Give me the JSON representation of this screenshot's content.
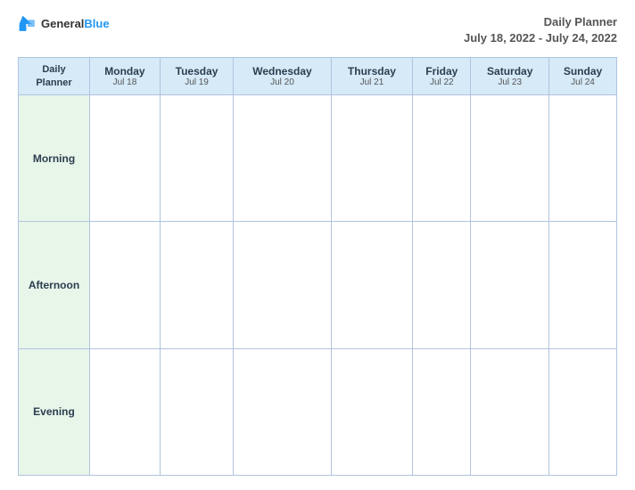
{
  "logo": {
    "brand": "General",
    "brand_blue": "Blue"
  },
  "header": {
    "title": "Daily Planner",
    "date_range": "July 18, 2022 - July 24, 2022"
  },
  "table": {
    "first_col": {
      "line1": "Daily",
      "line2": "Planner"
    },
    "columns": [
      {
        "day": "Monday",
        "date": "Jul 18"
      },
      {
        "day": "Tuesday",
        "date": "Jul 19"
      },
      {
        "day": "Wednesday",
        "date": "Jul 20"
      },
      {
        "day": "Thursday",
        "date": "Jul 21"
      },
      {
        "day": "Friday",
        "date": "Jul 22"
      },
      {
        "day": "Saturday",
        "date": "Jul 23"
      },
      {
        "day": "Sunday",
        "date": "Jul 24"
      }
    ],
    "rows": [
      {
        "label": "Morning"
      },
      {
        "label": "Afternoon"
      },
      {
        "label": "Evening"
      }
    ]
  }
}
